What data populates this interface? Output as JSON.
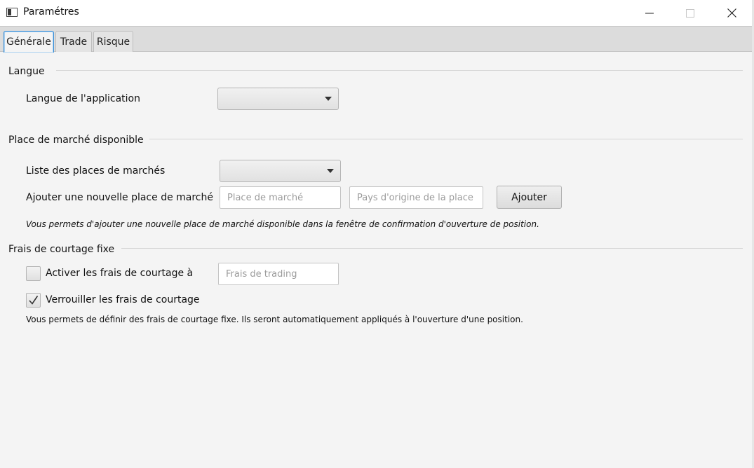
{
  "window": {
    "title": "Paramétres",
    "icons": {
      "app": "window-app-icon",
      "minimize": "minimize-icon",
      "maximize": "maximize-icon",
      "close": "close-icon"
    }
  },
  "tabs": [
    {
      "label": "Générale",
      "active": true
    },
    {
      "label": "Trade",
      "active": false
    },
    {
      "label": "Risque",
      "active": false
    }
  ],
  "langue": {
    "section_title": "Langue",
    "app_language_label": "Langue de l'application",
    "app_language_value": ""
  },
  "marche": {
    "section_title": "Place de marché disponible",
    "list_label": "Liste des places de marchés",
    "list_value": "",
    "add_label": "Ajouter une nouvelle place de marché",
    "market_placeholder": "Place de marché",
    "country_placeholder": "Pays d'origine de la place",
    "add_button": "Ajouter",
    "hint": "Vous permets d'ajouter une nouvelle place de marché disponible dans la fenêtre de confirmation d'ouverture de position."
  },
  "frais": {
    "section_title": "Frais de courtage fixe",
    "activate_label": "Activer les frais de courtage à",
    "activate_checked": false,
    "fees_placeholder": "Frais de trading",
    "lock_label": "Verrouiller les frais de courtage",
    "lock_checked": true,
    "hint": "Vous permets de définir des frais de courtage fixe. Ils seront automatiquement appliqués à l'ouverture d'une position."
  }
}
